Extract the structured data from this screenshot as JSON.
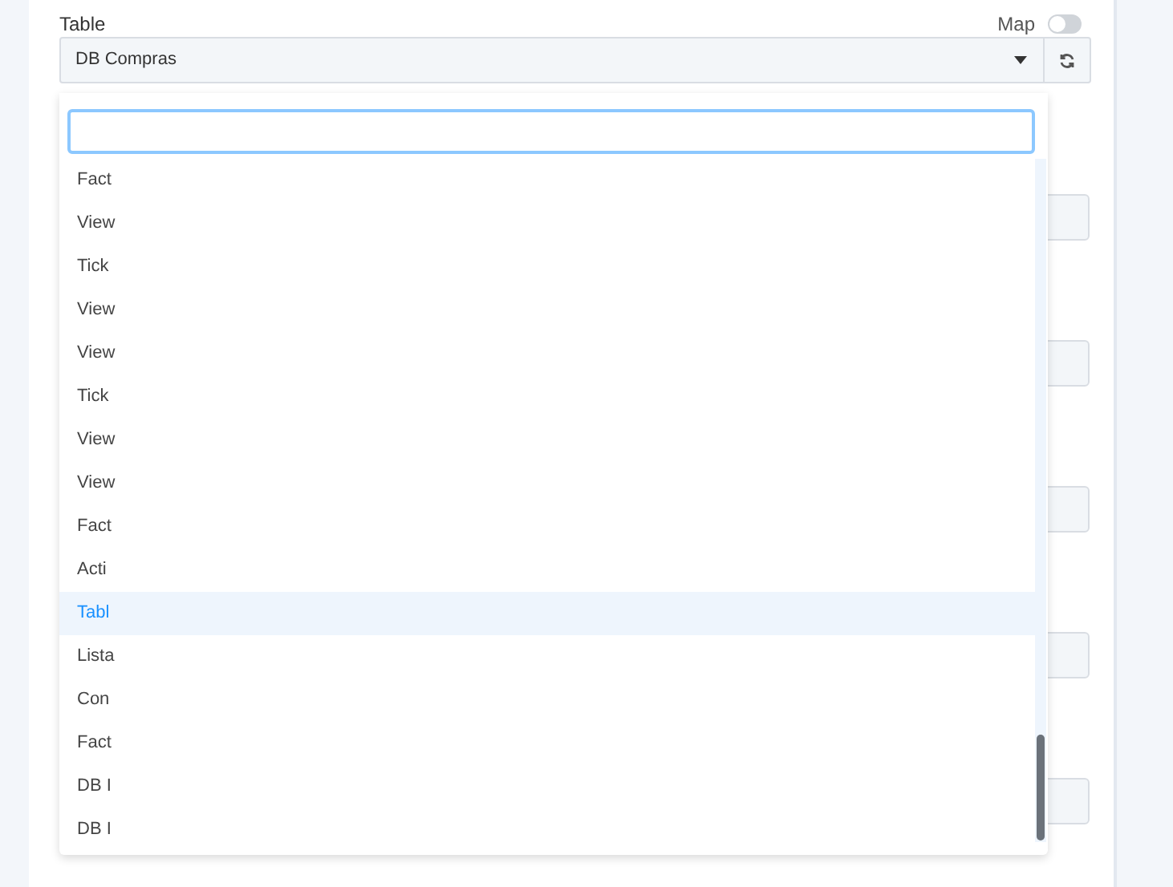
{
  "field": {
    "label": "Table",
    "value": "DB Compras"
  },
  "map_toggle": {
    "label": "Map",
    "on": false
  },
  "dropdown": {
    "search": {
      "focused": true
    },
    "items": [
      {
        "label": "Fact",
        "selected": false
      },
      {
        "label": "View",
        "selected": false
      },
      {
        "label": "Tick",
        "selected": false
      },
      {
        "label": "View",
        "selected": false
      },
      {
        "label": "View",
        "selected": false
      },
      {
        "label": "Tick",
        "selected": false
      },
      {
        "label": "View",
        "selected": false
      },
      {
        "label": "View",
        "selected": false
      },
      {
        "label": "Fact",
        "selected": false
      },
      {
        "label": "Acti",
        "selected": false
      },
      {
        "label": "Tabl",
        "selected": true
      },
      {
        "label": "Lista",
        "selected": false
      },
      {
        "label": "Con",
        "selected": false
      },
      {
        "label": "Fact",
        "selected": false
      },
      {
        "label": "DB I",
        "selected": false
      },
      {
        "label": "DB I",
        "selected": false
      }
    ]
  },
  "background_fields": [
    {
      "kind": "input"
    },
    {
      "kind": "input"
    },
    {
      "kind": "input"
    },
    {
      "kind": "input"
    },
    {
      "kind": "input"
    }
  ]
}
